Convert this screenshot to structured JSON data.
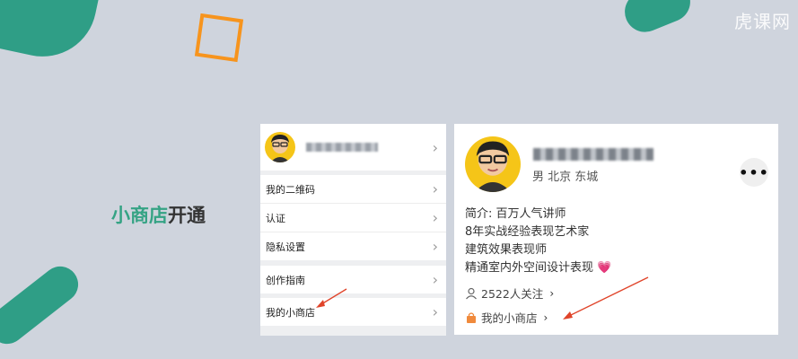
{
  "watermark": "虎课网",
  "slide_title": {
    "part1": "小商店",
    "part2": "开通"
  },
  "menu": {
    "items": [
      {
        "label": "我的二维码"
      },
      {
        "label": "认证"
      },
      {
        "label": "隐私设置"
      },
      {
        "label": "创作指南"
      },
      {
        "label": "我的小商店"
      }
    ]
  },
  "profile": {
    "meta": "男  北京 东城",
    "more": "•••",
    "bio_lines": [
      "简介: 百万人气讲师",
      "8年实战经验表现艺术家",
      "建筑效果表现师",
      "精通室内外空间设计表现"
    ],
    "heart_icon": "💗",
    "follow": "2522人关注",
    "shop": "我的小商店"
  },
  "colors": {
    "accent_green": "#35a384",
    "teal": "#2f9e86",
    "orange": "#f7941d",
    "arrow_red": "#e0442a",
    "avatar_yellow": "#f5c518"
  }
}
